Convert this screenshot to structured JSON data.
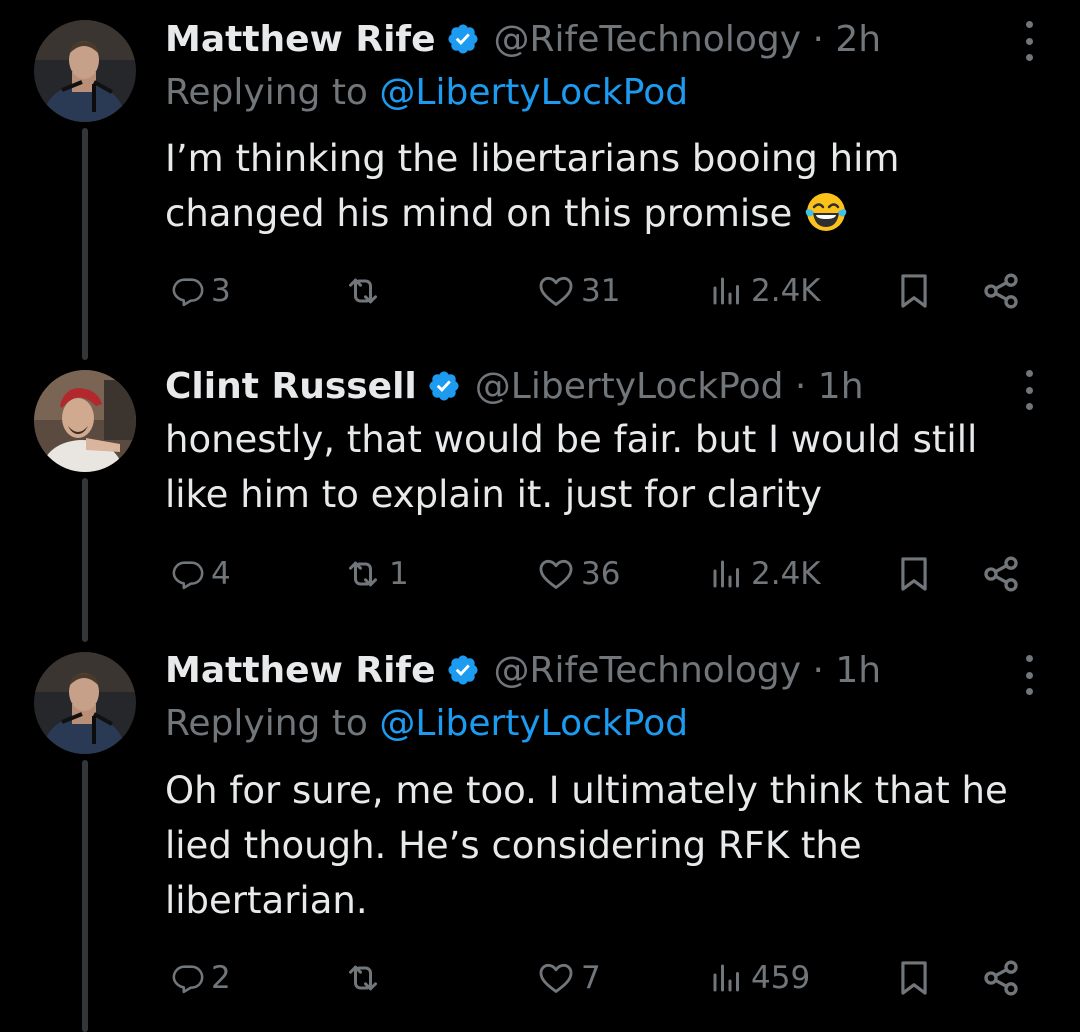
{
  "tweets": [
    {
      "name": "Matthew Rife",
      "handle": "@RifeTechnology · 2h",
      "replying_prefix": "Replying to ",
      "replying_to": "@LibertyLockPod",
      "text_lines": [
        "I’m thinking the libertarians booing him",
        "changed his mind on this promise"
      ],
      "emoji": "face-with-tears-of-joy",
      "replies": "3",
      "retweets": "",
      "likes": "31",
      "views": "2.4K"
    },
    {
      "name": "Clint Russell",
      "handle": "@LibertyLockPod · 1h",
      "text_lines": [
        "honestly, that would be fair. but I would still",
        "like him to explain it. just for clarity"
      ],
      "replies": "4",
      "retweets": "1",
      "likes": "36",
      "views": "2.4K"
    },
    {
      "name": "Matthew Rife",
      "handle": "@RifeTechnology · 1h",
      "replying_prefix": "Replying to ",
      "replying_to": "@LibertyLockPod",
      "text_lines": [
        "Oh for sure, me too. I ultimately think that he",
        "lied though. He’s considering RFK the",
        "libertarian."
      ],
      "replies": "2",
      "retweets": "",
      "likes": "7",
      "views": "459"
    }
  ],
  "colors": {
    "background": "#000000",
    "text": "#e7e9ea",
    "muted": "#71767b",
    "link": "#1d9bf0",
    "verified": "#1d9bf0"
  },
  "icons": [
    "verified-badge-icon",
    "more-icon",
    "reply-icon",
    "retweet-icon",
    "like-icon",
    "views-icon",
    "bookmark-icon",
    "share-icon"
  ]
}
